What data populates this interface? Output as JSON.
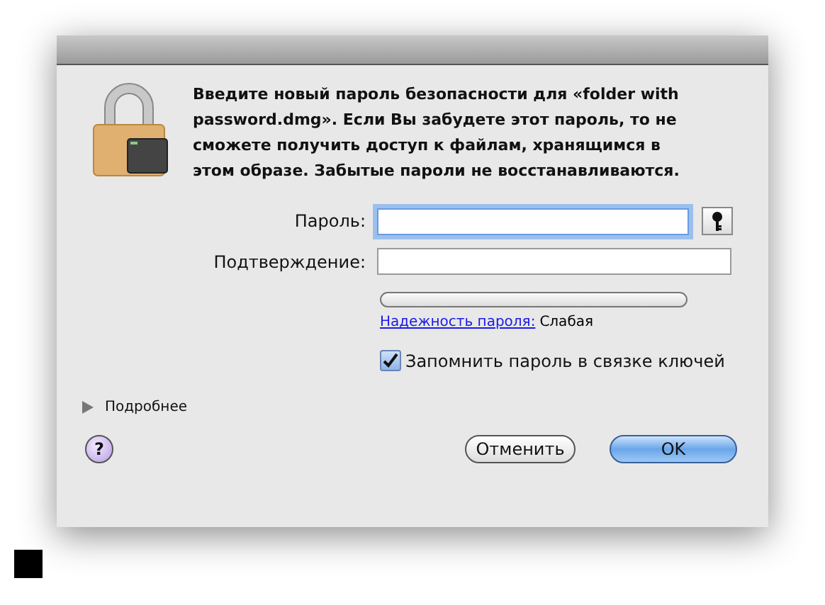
{
  "dialog": {
    "message": "Введите новый пароль безопасности для «folder with password.dmg». Если Вы забудете этот пароль, то не сможете получить доступ к файлам, хранящимся в этом образе. Забытые пароли не восстанавливаются.",
    "fields": [
      {
        "label": "Пароль:",
        "focused": true
      },
      {
        "label": "Подтверждение:",
        "focused": false
      }
    ],
    "strength": {
      "link": "Надежность пароля:",
      "value": "Слабая"
    },
    "remember": {
      "label": "Запомнить пароль в связке ключей",
      "checked": true
    },
    "details": {
      "label": "Подробнее",
      "expanded": false
    },
    "help": "?",
    "buttons": [
      {
        "label": "Отменить",
        "default": false
      },
      {
        "label": "OK",
        "default": true
      }
    ]
  }
}
